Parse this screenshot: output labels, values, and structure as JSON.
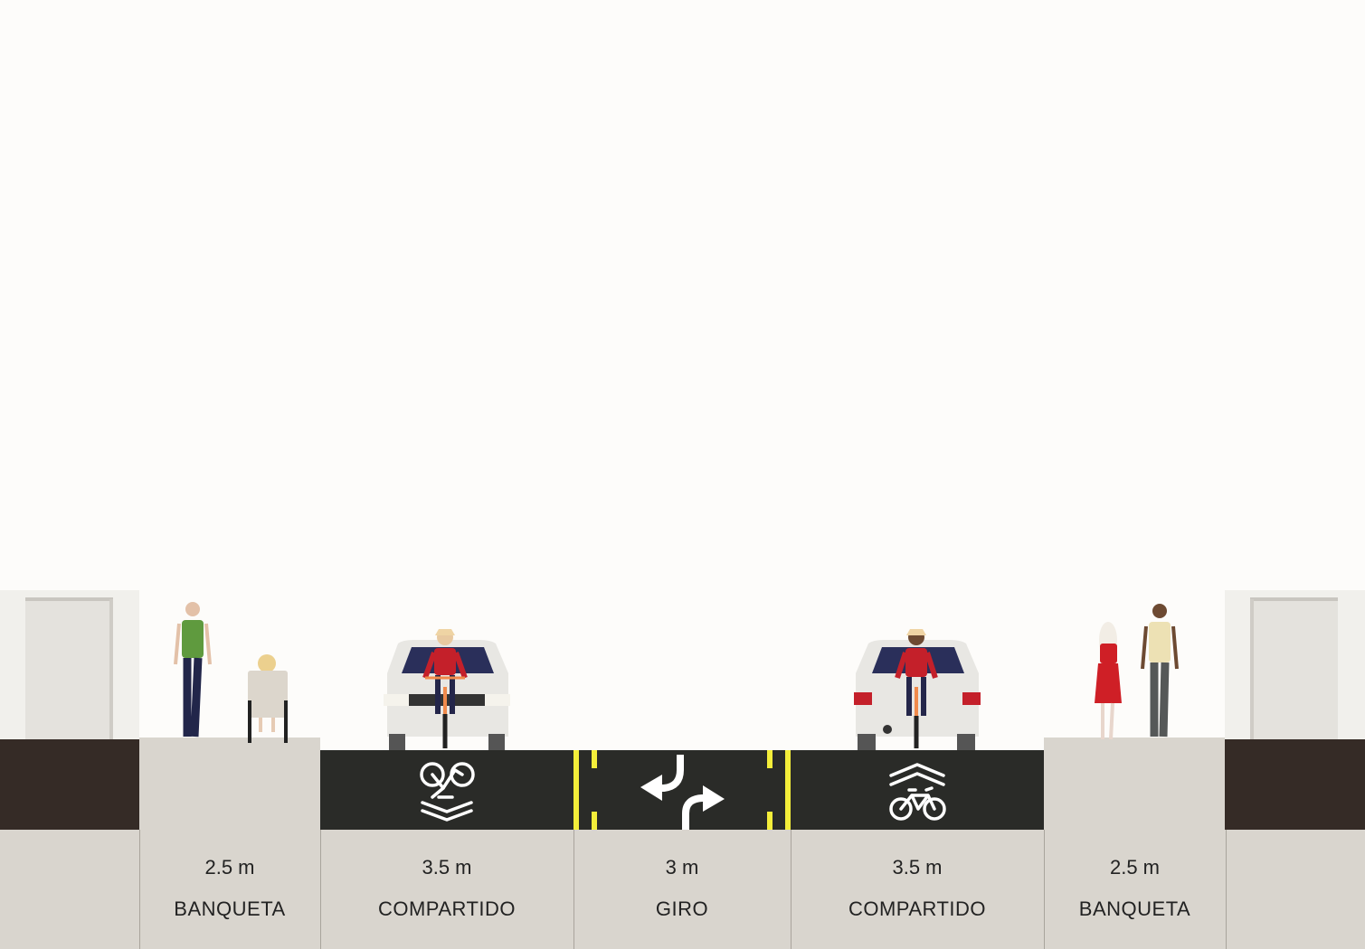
{
  "segments": [
    {
      "width": "2.5 m",
      "name": "BANQUETA"
    },
    {
      "width": "3.5 m",
      "name": "COMPARTIDO"
    },
    {
      "width": "3 m",
      "name": "GIRO"
    },
    {
      "width": "3.5 m",
      "name": "COMPARTIDO"
    },
    {
      "width": "2.5 m",
      "name": "BANQUETA"
    }
  ],
  "colors": {
    "sky": "#fdfcfa",
    "asphalt": "#2a2b28",
    "sidewalk": "#d9d5ce",
    "ground": "#352b26",
    "yellow_line": "#f4ee3a",
    "marking": "#ffffff"
  },
  "icons": [
    "bike-sharrow-icon",
    "left-turn-arrow-icon",
    "right-turn-arrow-icon",
    "bike-chevron-icon"
  ]
}
